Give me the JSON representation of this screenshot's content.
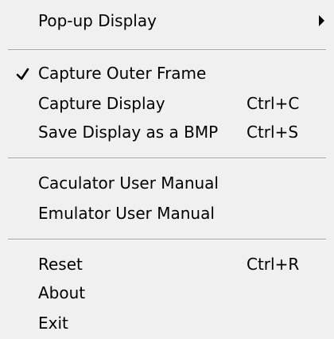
{
  "menu": {
    "popup_display": {
      "label": "Pop-up Display",
      "submenu_icon": "submenu-arrow-icon"
    },
    "capture_outer_frame": {
      "label": "Capture Outer Frame",
      "checked": true,
      "check_icon": "checkmark-icon"
    },
    "capture_display": {
      "label": "Capture Display",
      "shortcut": "Ctrl+C"
    },
    "save_bmp": {
      "label": "Save Display as a BMP",
      "shortcut": "Ctrl+S"
    },
    "calculator_manual": {
      "label": "Caculator User Manual"
    },
    "emulator_manual": {
      "label": "Emulator User Manual"
    },
    "reset": {
      "label": "Reset",
      "shortcut": "Ctrl+R"
    },
    "about": {
      "label": "About"
    },
    "exit": {
      "label": "Exit"
    }
  },
  "colors": {
    "background": "#f0f0f0",
    "text": "#000000",
    "separator_dark": "#a0a0a0",
    "separator_light": "#ffffff"
  }
}
